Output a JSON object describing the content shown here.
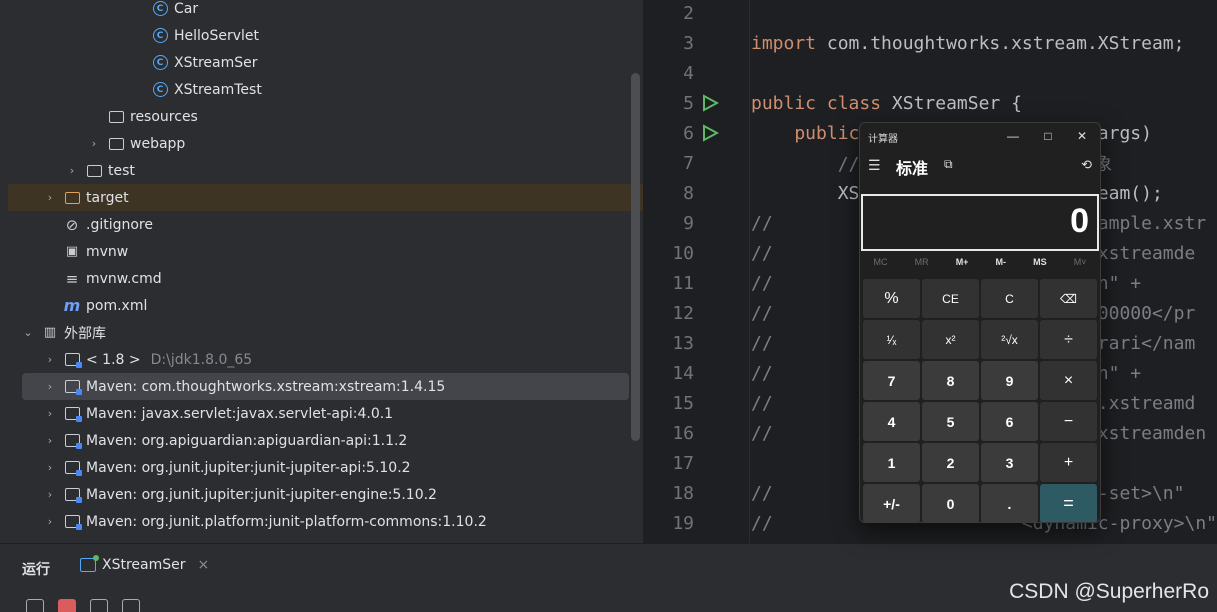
{
  "project_tree": [
    {
      "label": "Car",
      "icon": "class-icon",
      "indent": 152,
      "chevron": false
    },
    {
      "label": "HelloServlet",
      "icon": "class-icon",
      "indent": 152,
      "chevron": false
    },
    {
      "label": "XStreamSer",
      "icon": "runnable-class-icon",
      "indent": 152,
      "chevron": false
    },
    {
      "label": "XStreamTest",
      "icon": "runnable-class-icon",
      "indent": 152,
      "chevron": false
    },
    {
      "label": "resources",
      "icon": "resources-folder-icon",
      "indent": 108,
      "chevron": false
    },
    {
      "label": "webapp",
      "icon": "web-folder-icon",
      "indent": 108,
      "chevron": true
    },
    {
      "label": "test",
      "icon": "folder-icon",
      "indent": 86,
      "chevron": true
    },
    {
      "label": "target",
      "icon": "excluded-folder-icon",
      "indent": 64,
      "chevron": true,
      "highlight": true
    },
    {
      "label": ".gitignore",
      "icon": "ignore-file-icon",
      "indent": 64,
      "chevron": false
    },
    {
      "label": "mvnw",
      "icon": "terminal-file-icon",
      "indent": 64,
      "chevron": false
    },
    {
      "label": "mvnw.cmd",
      "icon": "text-file-icon",
      "indent": 64,
      "chevron": false
    },
    {
      "label": "pom.xml",
      "icon": "maven-icon",
      "indent": 64,
      "chevron": false
    },
    {
      "label": "外部库",
      "icon": "library-root-icon",
      "indent": 42,
      "chevron": true,
      "expanded": true
    },
    {
      "label": "< 1.8 >",
      "dim": "D:\\jdk1.8.0_65",
      "icon": "jdk-icon",
      "indent": 64,
      "chevron": true
    },
    {
      "label": "Maven: com.thoughtworks.xstream:xstream:1.4.15",
      "icon": "library-icon",
      "indent": 64,
      "chevron": true,
      "selected": true
    },
    {
      "label": "Maven: javax.servlet:javax.servlet-api:4.0.1",
      "icon": "library-icon",
      "indent": 64,
      "chevron": true
    },
    {
      "label": "Maven: org.apiguardian:apiguardian-api:1.1.2",
      "icon": "library-icon",
      "indent": 64,
      "chevron": true
    },
    {
      "label": "Maven: org.junit.jupiter:junit-jupiter-api:5.10.2",
      "icon": "library-icon",
      "indent": 64,
      "chevron": true
    },
    {
      "label": "Maven: org.junit.jupiter:junit-jupiter-engine:5.10.2",
      "icon": "library-icon",
      "indent": 64,
      "chevron": true
    },
    {
      "label": "Maven: org.junit.platform:junit-platform-commons:1.10.2",
      "icon": "library-icon",
      "indent": 64,
      "chevron": true
    }
  ],
  "editor_lines": [
    {
      "n": "2",
      "code": ""
    },
    {
      "n": "3",
      "parts": [
        {
          "t": "import ",
          "c": "kw"
        },
        {
          "t": "com.thoughtworks.xstream.XStream;",
          "c": ""
        }
      ]
    },
    {
      "n": "4",
      "code": ""
    },
    {
      "n": "5",
      "run": true,
      "parts": [
        {
          "t": "public class ",
          "c": "kw"
        },
        {
          "t": "XStreamSer {",
          "c": ""
        }
      ]
    },
    {
      "n": "6",
      "run": true,
      "parts": [
        {
          "t": "    public ",
          "c": "kw"
        },
        {
          "t": "                ng[] args) ",
          "c": ""
        }
      ]
    },
    {
      "n": "7",
      "parts": [
        {
          "t": "        //                    对象",
          "c": "cm"
        }
      ]
    },
    {
      "n": "8",
      "parts": [
        {
          "t": "        XS                    tream();",
          "c": ""
        }
      ]
    },
    {
      "n": "9",
      "parts": [
        {
          "t": "//                             xample.xstr",
          "c": "cm"
        }
      ]
    },
    {
      "n": "10",
      "parts": [
        {
          "t": "//                            e.xstreamde",
          "c": "cm"
        }
      ]
    },
    {
      "n": "11",
      "parts": [
        {
          "t": "//                            >\\n\" +",
          "c": "cm"
        }
      ]
    },
    {
      "n": "12",
      "parts": [
        {
          "t": "//                            4000000</pr",
          "c": "cm"
        }
      ]
    },
    {
      "n": "13",
      "parts": [
        {
          "t": "//                            errari</nam",
          "c": "cm"
        }
      ]
    },
    {
      "n": "14",
      "parts": [
        {
          "t": "//                            >\\n\" +",
          "c": "cm"
        }
      ]
    },
    {
      "n": "15",
      "parts": [
        {
          "t": "//                            le.xstreamd",
          "c": "cm"
        }
      ]
    },
    {
      "n": "16",
      "parts": [
        {
          "t": "//                            e.xstreamden",
          "c": "cm"
        }
      ]
    },
    {
      "n": "17",
      "code": ""
    },
    {
      "n": "18",
      "parts": [
        {
          "t": "//                           ted-set>\\n\"",
          "c": "cm"
        }
      ]
    },
    {
      "n": "19",
      "parts": [
        {
          "t": "//                       <dynamic-proxy>\\n\" +",
          "c": "cm"
        }
      ]
    }
  ],
  "run_panel": {
    "title": "运行",
    "tab_label": "XStreamSer",
    "tab_close": "×"
  },
  "watermark": "CSDN @SuperherRo",
  "calculator": {
    "title": "计算器",
    "mode": "标准",
    "display": "0",
    "minimize": "—",
    "maximize": "□",
    "close": "✕",
    "memory": [
      {
        "label": "MC",
        "enabled": false
      },
      {
        "label": "MR",
        "enabled": false
      },
      {
        "label": "M+",
        "enabled": true
      },
      {
        "label": "M-",
        "enabled": true
      },
      {
        "label": "MS",
        "enabled": true
      },
      {
        "label": "M˅",
        "enabled": false
      }
    ],
    "keys": [
      {
        "label": "%",
        "kind": "op",
        "name": "percent-key"
      },
      {
        "label": "CE",
        "kind": "fn",
        "name": "clear-entry-key"
      },
      {
        "label": "C",
        "kind": "fn",
        "name": "clear-key"
      },
      {
        "label": "⌫",
        "kind": "fn",
        "name": "backspace-key"
      },
      {
        "label": "¹⁄ₓ",
        "kind": "fn",
        "name": "reciprocal-key"
      },
      {
        "label": "x²",
        "kind": "fn",
        "name": "square-key"
      },
      {
        "label": "²√x",
        "kind": "fn",
        "name": "sqrt-key"
      },
      {
        "label": "÷",
        "kind": "op",
        "name": "divide-key"
      },
      {
        "label": "7",
        "kind": "num",
        "name": "digit-7-key"
      },
      {
        "label": "8",
        "kind": "num",
        "name": "digit-8-key"
      },
      {
        "label": "9",
        "kind": "num",
        "name": "digit-9-key"
      },
      {
        "label": "×",
        "kind": "op",
        "name": "multiply-key"
      },
      {
        "label": "4",
        "kind": "num",
        "name": "digit-4-key"
      },
      {
        "label": "5",
        "kind": "num",
        "name": "digit-5-key"
      },
      {
        "label": "6",
        "kind": "num",
        "name": "digit-6-key"
      },
      {
        "label": "−",
        "kind": "op",
        "name": "subtract-key"
      },
      {
        "label": "1",
        "kind": "num",
        "name": "digit-1-key"
      },
      {
        "label": "2",
        "kind": "num",
        "name": "digit-2-key"
      },
      {
        "label": "3",
        "kind": "num",
        "name": "digit-3-key"
      },
      {
        "label": "+",
        "kind": "op",
        "name": "add-key"
      },
      {
        "label": "+/-",
        "kind": "num",
        "name": "negate-key"
      },
      {
        "label": "0",
        "kind": "num",
        "name": "digit-0-key"
      },
      {
        "label": ".",
        "kind": "num",
        "name": "decimal-key"
      },
      {
        "label": "=",
        "kind": "eq",
        "name": "equals-key"
      }
    ]
  },
  "colors": {
    "editor_bg": "#1e1f22",
    "panel_bg": "#2b2d30",
    "keyword": "#cf8e6d",
    "run_icon": "#5fb865",
    "equals_key": "#2e5a63"
  }
}
